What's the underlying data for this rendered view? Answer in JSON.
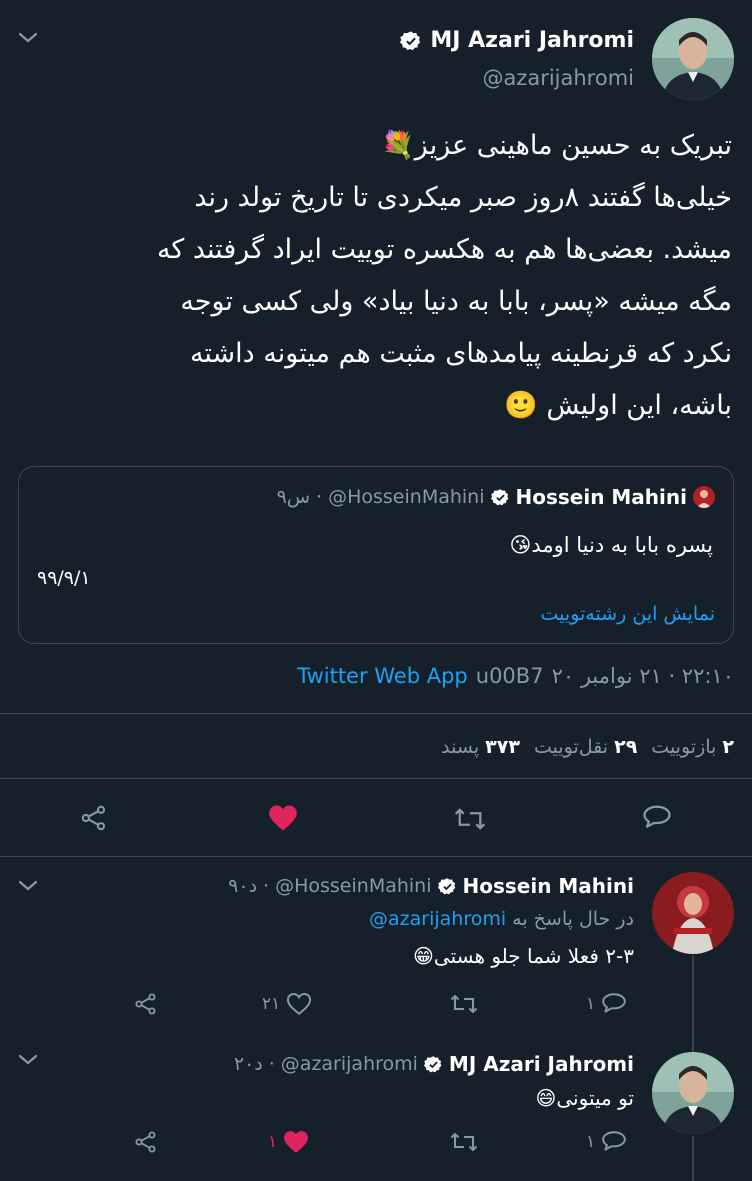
{
  "main_tweet": {
    "author_name": "MJ Azari Jahromi",
    "author_handle": "@azarijahromi",
    "text_lines": [
      "تبریک به حسین ماهینی عزیز💐",
      "خیلی‌ها گفتند ۸روز صبر میکردی تا تاریخ تولد رند",
      "میشد. بعضی‌ها هم به هکسره توییت ایراد گرفتند که",
      "مگه میشه «پسر، بابا به دنیا بیاد» ولی کسی توجه",
      "نکرد که قرنطینه پیامدهای مثبت هم میتونه داشته",
      "باشه، این اولیش 🙂"
    ],
    "quoted": {
      "author_name": "Hossein Mahini",
      "author_handle": "@HosseinMahini",
      "time": "۹س",
      "dot": "·",
      "text": "پسره بابا به دنیا اومد😘",
      "date_note": "۹۹/۹/۱",
      "thread_link": "نمایش این رشته‌توییت"
    },
    "meta": {
      "time_date": "۲۲:۱۰ · ۲۱ نوامبر ۲۰",
      "sep": "u00B7",
      "app": "Twitter Web App"
    },
    "stats": {
      "retweets_count": "۲",
      "retweets_label": "بازتوییت",
      "quotes_count": "۲۹",
      "quotes_label": "نقل‌توییت",
      "likes_count": "۳۷۳",
      "likes_label": "پسند"
    }
  },
  "replies": [
    {
      "author_name": "Hossein Mahini",
      "author_handle": "@HosseinMahini",
      "time": "۹۰د",
      "dot": "·",
      "replying_prefix": "در حال پاسخ به",
      "replying_to": "@azarijahromi",
      "text": "۲-۳ فعلا شما جلو هستی😁",
      "reply_count": "۱",
      "like_count": "۲۱"
    },
    {
      "author_name": "MJ Azari Jahromi",
      "author_handle": "@azarijahromi",
      "time": "۲۰د",
      "dot": "·",
      "text": "تو میتونی😄",
      "reply_count": "۱",
      "like_count": "۱"
    }
  ],
  "colors": {
    "background": "#15202b",
    "text": "#ffffff",
    "muted": "#8899a6",
    "link": "#1da1f2",
    "like": "#e0245e",
    "divider": "#38444d"
  }
}
